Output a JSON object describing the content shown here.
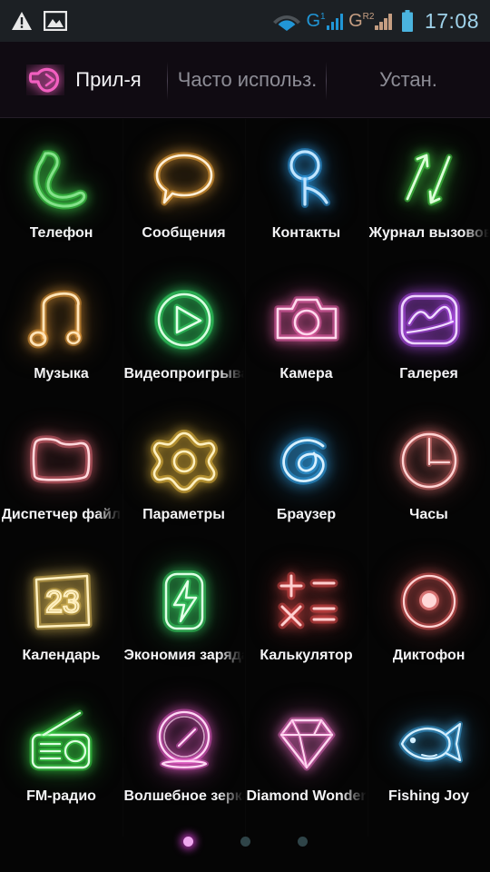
{
  "status_bar": {
    "warning_icon": "warning-triangle-icon",
    "image_icon": "image-icon",
    "wifi_icon": "wifi-icon",
    "sim1": {
      "letter": "G",
      "sup": "1",
      "bars": 4,
      "color": "#2196d6"
    },
    "sim2": {
      "letter": "G",
      "sup_r": "R",
      "sup_n": "2",
      "bars": 4,
      "color": "#c59e82"
    },
    "battery_icon": "battery-icon",
    "battery_color": "#4ab3de",
    "time": "17:08"
  },
  "tabs": [
    {
      "label": "Прил-я",
      "icon": "apps-arrow-icon",
      "active": true
    },
    {
      "label": "Часто использ.",
      "active": false
    },
    {
      "label": "Устан.",
      "active": false
    }
  ],
  "apps": [
    {
      "label": "Телефон",
      "icon": "phone-handset-icon",
      "color": "#3fcf4a",
      "clipped": false
    },
    {
      "label": "Сообщения",
      "icon": "speech-bubble-icon",
      "color": "#f2a73b",
      "clipped": false
    },
    {
      "label": "Контакты",
      "icon": "person-icon",
      "color": "#2f9fea",
      "clipped": false
    },
    {
      "label": "Журнал вызовов",
      "icon": "call-arrows-icon",
      "color": "#4ae04a",
      "clipped": true
    },
    {
      "label": "Музыка",
      "icon": "music-note-icon",
      "color": "#f0a23c",
      "clipped": false
    },
    {
      "label": "Видеопроигрыватель",
      "icon": "video-play-icon",
      "color": "#36e06a",
      "clipped": true
    },
    {
      "label": "Камера",
      "icon": "camera-icon",
      "color": "#f263b0",
      "clipped": false
    },
    {
      "label": "Галерея",
      "icon": "gallery-icon",
      "color": "#b44ef0",
      "clipped": false
    },
    {
      "label": "Диспетчер файлов",
      "icon": "folder-icon",
      "color": "#f2707f",
      "clipped": true
    },
    {
      "label": "Параметры",
      "icon": "gear-icon",
      "color": "#f0c040",
      "clipped": false
    },
    {
      "label": "Браузер",
      "icon": "browser-e-icon",
      "color": "#34a8f0",
      "clipped": false
    },
    {
      "label": "Часы",
      "icon": "clock-icon",
      "color": "#f07a7a",
      "clipped": false
    },
    {
      "label": "Календарь",
      "icon": "calendar-icon",
      "color": "#e8c45a",
      "day": "23",
      "clipped": false
    },
    {
      "label": "Экономия заряда",
      "icon": "battery-bolt-icon",
      "color": "#3ce06a",
      "clipped": true
    },
    {
      "label": "Калькулятор",
      "icon": "calculator-icon",
      "color": "#f05050",
      "clipped": false
    },
    {
      "label": "Диктофон",
      "icon": "recorder-icon",
      "color": "#f06060",
      "clipped": false
    },
    {
      "label": "FM-радио",
      "icon": "radio-icon",
      "color": "#3ce04a",
      "clipped": false
    },
    {
      "label": "Волшебное зеркало",
      "icon": "mirror-icon",
      "color": "#f060d0",
      "clipped": true
    },
    {
      "label": "Diamond Wonderland",
      "icon": "diamond-icon",
      "color": "#f070c8",
      "clipped": true
    },
    {
      "label": "Fishing Joy",
      "icon": "fish-icon",
      "color": "#40b0f0",
      "clipped": false
    }
  ],
  "page_dots": {
    "count": 3,
    "active_index": 0,
    "active_color": "#f0a8f0",
    "inactive_color": "#2f4448"
  }
}
